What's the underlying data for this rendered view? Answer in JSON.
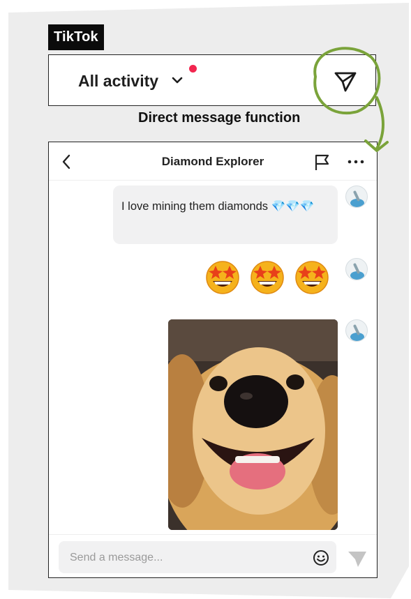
{
  "brand": {
    "label": "TikTok"
  },
  "activity_bar": {
    "title": "All activity",
    "chevron_icon": "chevron-down-icon",
    "notification_color": "#f2264f",
    "dm_icon": "paper-plane-icon"
  },
  "annotation": {
    "caption": "Direct message function",
    "highlight_color": "#7aa33a"
  },
  "chat": {
    "title": "Diamond Explorer",
    "back_icon": "chevron-left-icon",
    "report_icon": "flag-icon",
    "more_icon": "more-dots-icon",
    "messages": [
      {
        "type": "text",
        "text": "I love mining them diamonds 💎💎💎"
      },
      {
        "type": "emoji",
        "emojis": [
          "🤩",
          "🤩",
          "🤩"
        ]
      },
      {
        "type": "image",
        "image": "dog-photo"
      }
    ],
    "input": {
      "placeholder": "Send a message...",
      "value": ""
    },
    "emoji_icon": "smiley-icon",
    "send_icon": "send-icon"
  }
}
